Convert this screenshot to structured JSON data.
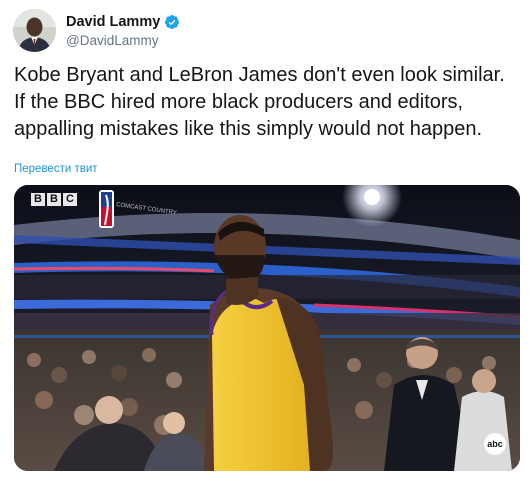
{
  "author": {
    "display_name": "David Lammy",
    "handle": "@DavidLammy",
    "verified": true,
    "verified_icon": "verified-badge-icon"
  },
  "tweet": {
    "lines": [
      "Kobe Bryant and LeBron James don't even look similar.",
      "If the BBC hired more black producers and editors,",
      "appalling mistakes like this simply would not happen."
    ]
  },
  "translate_link": "Перевести твит",
  "media": {
    "broadcaster_logo": [
      "B",
      "B",
      "C"
    ],
    "network_bug": "abc",
    "colors": {
      "jersey": "#f2c230",
      "arena_dark": "#1a1d2e",
      "led_ribbon": "#2b5fc9"
    }
  },
  "colors": {
    "link": "#1b95e0",
    "verified": "#1da1f2",
    "secondary_text": "#657786"
  }
}
